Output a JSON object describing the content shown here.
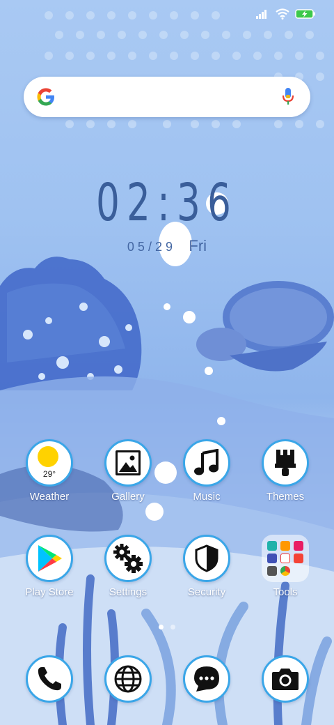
{
  "status_bar": {
    "icons": [
      "signal-icon",
      "wifi-icon",
      "battery-charging-icon"
    ],
    "battery_color": "#3cc84a"
  },
  "search_bar": {
    "logo": "google-g-icon",
    "mic": "mic-icon"
  },
  "clock": {
    "time": "02:36",
    "date": "05/29",
    "weekday": "Fri"
  },
  "home_apps": [
    {
      "label": "Weather",
      "icon": "weather-sun-icon",
      "temperature": "29°"
    },
    {
      "label": "Gallery",
      "icon": "gallery-icon"
    },
    {
      "label": "Music",
      "icon": "music-note-icon"
    },
    {
      "label": "Themes",
      "icon": "paintbrush-icon"
    },
    {
      "label": "Play Store",
      "icon": "play-store-icon"
    },
    {
      "label": "Settings",
      "icon": "gears-icon"
    },
    {
      "label": "Security",
      "icon": "shield-icon"
    },
    {
      "label": "Tools",
      "icon": "folder-icon"
    }
  ],
  "page_indicator": {
    "pages": 2,
    "current": 1
  },
  "dock": [
    {
      "name": "phone",
      "icon": "phone-icon"
    },
    {
      "name": "browser",
      "icon": "globe-icon"
    },
    {
      "name": "messages",
      "icon": "chat-bubble-icon"
    },
    {
      "name": "camera",
      "icon": "camera-icon"
    }
  ],
  "colors": {
    "icon_ring": "#3aa6e8",
    "clock_text": "#3a5e9a",
    "accent_yellow": "#ffd200"
  }
}
